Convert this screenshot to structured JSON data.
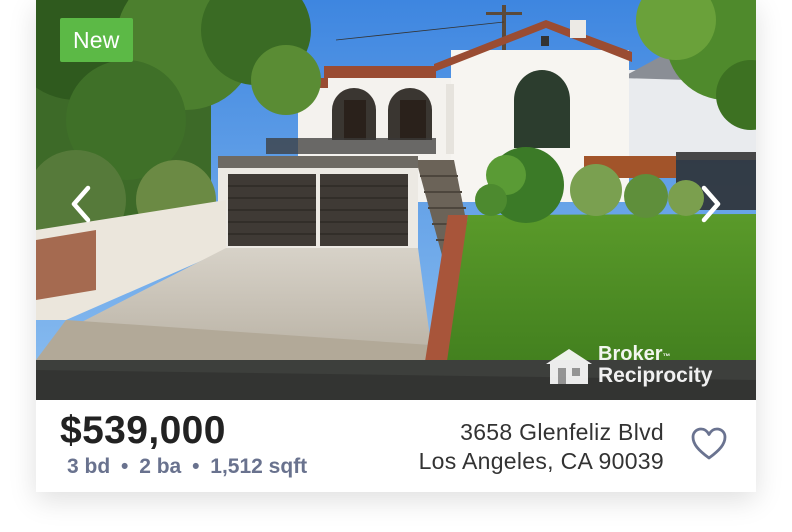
{
  "listing": {
    "badge": "New",
    "price": "$539,000",
    "beds": "3 bd",
    "baths": "2 ba",
    "sqft": "1,512 sqft",
    "separator": "•",
    "address_line1": "3658 Glenfeliz Blvd",
    "address_line2": "Los Angeles, CA 90039"
  },
  "watermark": {
    "line1": "Broker",
    "trademark": "™",
    "line2": "Reciprocity"
  },
  "icons": {
    "prev": "chevron-left-icon",
    "next": "chevron-right-icon",
    "favorite": "heart-outline-icon",
    "watermark_logo": "house-icon"
  },
  "colors": {
    "badge": "#5cb946",
    "specs_text": "#69728e",
    "price_text": "#222222"
  }
}
